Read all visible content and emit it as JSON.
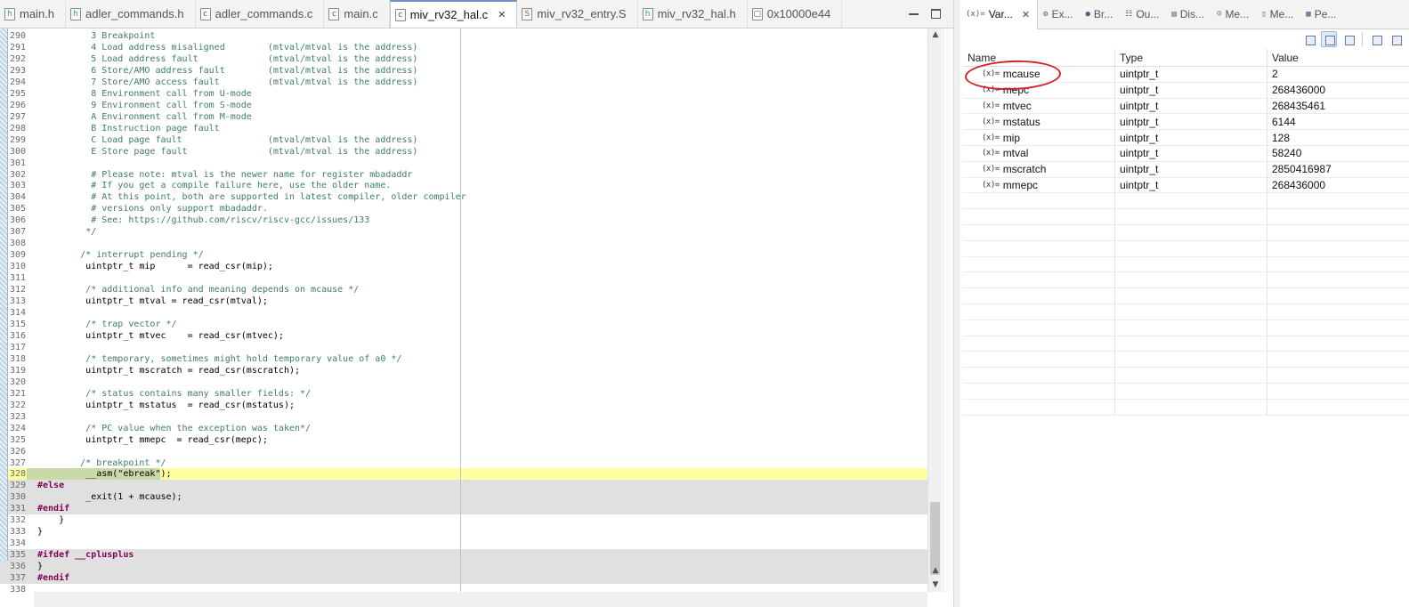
{
  "editor": {
    "tabs": [
      {
        "label": "main.h",
        "icon": "h-file-icon",
        "badge": "h"
      },
      {
        "label": "adler_commands.h",
        "icon": "h-file-icon",
        "badge": "h"
      },
      {
        "label": "adler_commands.c",
        "icon": "c-file-icon",
        "badge": "c"
      },
      {
        "label": "main.c",
        "icon": "c-file-icon",
        "badge": "c"
      },
      {
        "label": "miv_rv32_hal.c",
        "icon": "c-file-icon",
        "badge": "c",
        "active": true,
        "close": "✕"
      },
      {
        "label": "miv_rv32_entry.S",
        "icon": "s-file-icon",
        "badge": "S"
      },
      {
        "label": "miv_rv32_hal.h",
        "icon": "h-file-icon",
        "badge": "h"
      },
      {
        "label": "0x10000e44",
        "icon": "disassembly-icon",
        "badge": "▢"
      }
    ],
    "lines": [
      {
        "n": "290",
        "text": "          3 Breakpoint",
        "style": "c"
      },
      {
        "n": "291",
        "text": "          4 Load address misaligned        (mtval/mtval is the address)",
        "style": "c"
      },
      {
        "n": "292",
        "text": "          5 Load address fault             (mtval/mtval is the address)",
        "style": "c"
      },
      {
        "n": "293",
        "text": "          6 Store/AMO address fault        (mtval/mtval is the address)",
        "style": "c"
      },
      {
        "n": "294",
        "text": "          7 Store/AMO access fault         (mtval/mtval is the address)",
        "style": "c"
      },
      {
        "n": "295",
        "text": "          8 Environment call from U-mode",
        "style": "c"
      },
      {
        "n": "296",
        "text": "          9 Environment call from S-mode",
        "style": "c"
      },
      {
        "n": "297",
        "text": "          A Environment call from M-mode",
        "style": "c"
      },
      {
        "n": "298",
        "text": "          B Instruction page fault",
        "style": "c"
      },
      {
        "n": "299",
        "text": "          C Load page fault                (mtval/mtval is the address)",
        "style": "c"
      },
      {
        "n": "300",
        "text": "          E Store page fault               (mtval/mtval is the address)",
        "style": "c"
      },
      {
        "n": "301",
        "text": "",
        "style": "c"
      },
      {
        "n": "302",
        "text": "          # Please note: mtval is the newer name for register mbadaddr",
        "style": "c"
      },
      {
        "n": "303",
        "text": "          # If you get a compile failure here, use the older name.",
        "style": "c"
      },
      {
        "n": "304",
        "text": "          # At this point, both are supported in latest compiler, older compiler",
        "style": "c"
      },
      {
        "n": "305",
        "text": "          # versions only support mbadaddr.",
        "style": "c"
      },
      {
        "n": "306",
        "text": "          # See: https://github.com/riscv/riscv-gcc/issues/133",
        "style": "c"
      },
      {
        "n": "307",
        "text": "         */",
        "style": "c"
      },
      {
        "n": "308",
        "text": "",
        "style": ""
      },
      {
        "n": "309",
        "text": "        /* interrupt pending */",
        "style": "c"
      },
      {
        "n": "310",
        "text": "         uintptr_t mip      = read_csr(mip);",
        "style": ""
      },
      {
        "n": "311",
        "text": "",
        "style": ""
      },
      {
        "n": "312",
        "text": "         /* additional info and meaning depends on mcause */",
        "style": "c"
      },
      {
        "n": "313",
        "text": "         uintptr_t mtval = read_csr(mtval);",
        "style": ""
      },
      {
        "n": "314",
        "text": "",
        "style": ""
      },
      {
        "n": "315",
        "text": "         /* trap vector */",
        "style": "c"
      },
      {
        "n": "316",
        "text": "         uintptr_t mtvec    = read_csr(mtvec);",
        "style": ""
      },
      {
        "n": "317",
        "text": "",
        "style": ""
      },
      {
        "n": "318",
        "text": "         /* temporary, sometimes might hold temporary value of a0 */",
        "style": "c"
      },
      {
        "n": "319",
        "text": "         uintptr_t mscratch = read_csr(mscratch);",
        "style": ""
      },
      {
        "n": "320",
        "text": "",
        "style": ""
      },
      {
        "n": "321",
        "text": "         /* status contains many smaller fields: */",
        "style": "c"
      },
      {
        "n": "322",
        "text": "         uintptr_t mstatus  = read_csr(mstatus);",
        "style": ""
      },
      {
        "n": "323",
        "text": "",
        "style": ""
      },
      {
        "n": "324",
        "text": "         /* PC value when the exception was taken*/",
        "style": "c"
      },
      {
        "n": "325",
        "text": "         uintptr_t mmepc  = read_csr(mepc);",
        "style": ""
      },
      {
        "n": "326",
        "text": "",
        "style": ""
      },
      {
        "n": "327",
        "text": "        /* breakpoint */",
        "style": "c"
      },
      {
        "n": "328",
        "text": "         __asm(\"ebreak\");",
        "style": "",
        "bg": "hl"
      },
      {
        "n": "329",
        "text": "#else",
        "style": "pp",
        "bg": "grey"
      },
      {
        "n": "330",
        "text": "         _exit(1 + mcause);",
        "style": "",
        "bg": "grey"
      },
      {
        "n": "331",
        "text": "#endif",
        "style": "pp",
        "bg": "grey"
      },
      {
        "n": "332",
        "text": "    }",
        "style": ""
      },
      {
        "n": "333",
        "text": "}",
        "style": ""
      },
      {
        "n": "334",
        "text": "",
        "style": ""
      },
      {
        "n": "335",
        "text": "#ifdef __cplusplus",
        "style": "pp",
        "bg": "grey"
      },
      {
        "n": "336",
        "text": "}",
        "style": "",
        "bg": "grey"
      },
      {
        "n": "337",
        "text": "#endif",
        "style": "pp",
        "bg": "grey"
      },
      {
        "n": "338",
        "text": "",
        "style": ""
      }
    ]
  },
  "views": {
    "tabs": [
      {
        "label": "Var...",
        "icon": "(x)=",
        "active": true,
        "close": "✕"
      },
      {
        "label": "Ex...",
        "icon": "⚙"
      },
      {
        "label": "Br...",
        "icon": "●"
      },
      {
        "label": "Ou...",
        "icon": "☷"
      },
      {
        "label": "Dis...",
        "icon": "▤"
      },
      {
        "label": "Me...",
        "icon": "☺"
      },
      {
        "label": "Me...",
        "icon": "▯"
      },
      {
        "label": "Pe...",
        "icon": "▦"
      }
    ]
  },
  "variables": {
    "columns": {
      "name": "Name",
      "type": "Type",
      "value": "Value"
    },
    "var_icon": "(x)=",
    "rows": [
      {
        "name": "mcause",
        "type": "uintptr_t",
        "value": "2"
      },
      {
        "name": "mepc",
        "type": "uintptr_t",
        "value": "268436000"
      },
      {
        "name": "mtvec",
        "type": "uintptr_t",
        "value": "268435461"
      },
      {
        "name": "mstatus",
        "type": "uintptr_t",
        "value": "6144"
      },
      {
        "name": "mip",
        "type": "uintptr_t",
        "value": "128"
      },
      {
        "name": "mtval",
        "type": "uintptr_t",
        "value": "58240"
      },
      {
        "name": "mscratch",
        "type": "uintptr_t",
        "value": "2850416987"
      },
      {
        "name": "mmepc",
        "type": "uintptr_t",
        "value": "268436000"
      }
    ],
    "empty_rows": 14
  },
  "colors": {
    "current_line": "#ffff9f",
    "inactive_code": "#e0e0e0",
    "annotation": "#d2232a"
  }
}
